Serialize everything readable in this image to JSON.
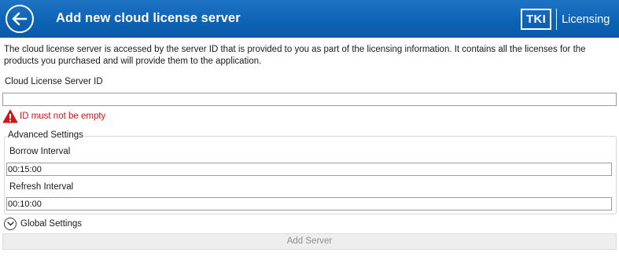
{
  "header": {
    "title": "Add new cloud license server",
    "logo_mark": "TKI",
    "logo_text": "Licensing"
  },
  "description": "The cloud license server is accessed by the server ID that is provided to you as part of the licensing information. It contains all the licenses for the products you purchased and will provide them to the application.",
  "server_id": {
    "label": "Cloud License Server ID",
    "value": ""
  },
  "validation": {
    "message": "ID must not be empty",
    "color": "#d0161b"
  },
  "advanced_settings": {
    "title": "Advanced Settings",
    "borrow_interval_label": "Borrow Interval",
    "borrow_interval_value": "00:15:00",
    "refresh_interval_label": "Refresh Interval",
    "refresh_interval_value": "00:10:00"
  },
  "global_settings": {
    "label": "Global Settings"
  },
  "actions": {
    "add_server_label": "Add Server"
  },
  "colors": {
    "header_blue": "#0d63b5",
    "disabled_text": "#8e8e8e"
  },
  "icons": [
    "back-arrow-icon",
    "warning-icon",
    "chevron-down-icon"
  ]
}
